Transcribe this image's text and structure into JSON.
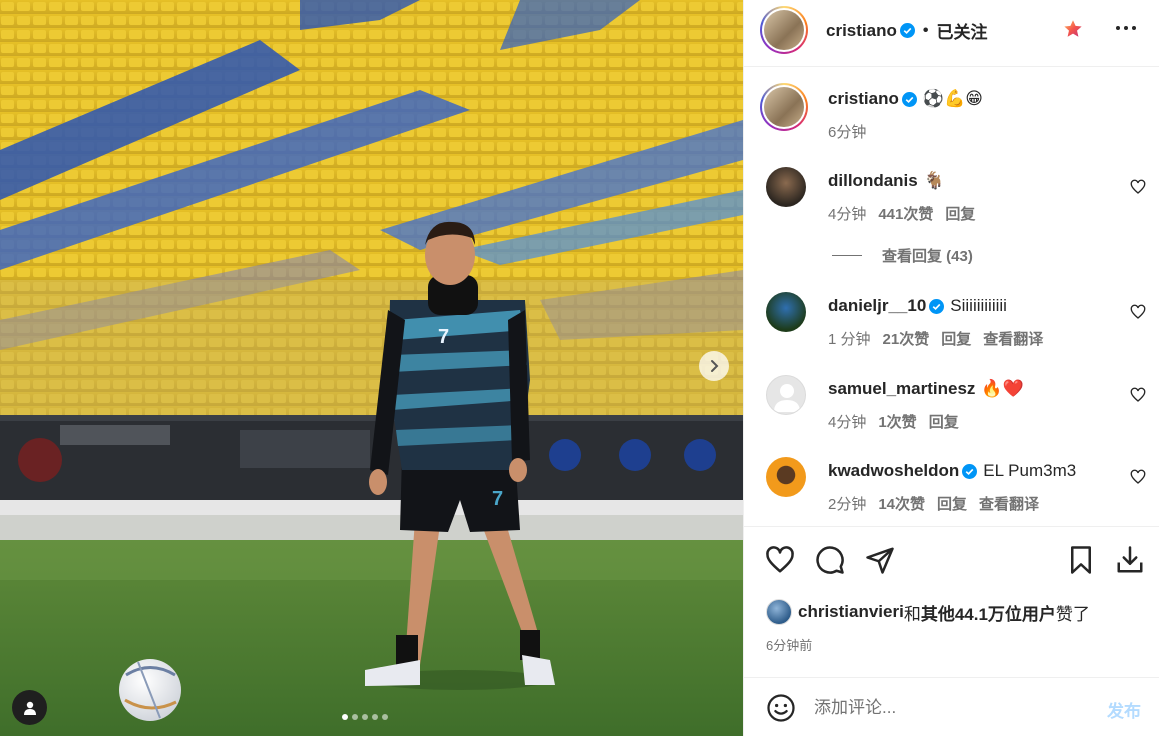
{
  "post": {
    "author": "cristiano",
    "follow_status": "已关注",
    "separator": "•",
    "caption_emoji": "⚽💪😁",
    "caption_time": "6分钟",
    "carousel_dots": 5,
    "active_dot": 1
  },
  "comments": [
    {
      "user": "dillondanis",
      "text": "🐐",
      "time": "4分钟",
      "likes": "441次赞",
      "reply": "回复",
      "translate": "",
      "verified": false
    },
    {
      "user": "danieljr__10",
      "text": "Siiiiiiiiiiii",
      "time": "1 分钟",
      "likes": "21次赞",
      "reply": "回复",
      "translate": "查看翻译",
      "verified": true
    },
    {
      "user": "samuel_martinesz",
      "text": "🔥❤️",
      "time": "4分钟",
      "likes": "1次赞",
      "reply": "回复",
      "translate": "",
      "verified": false
    },
    {
      "user": "kwadwosheldon",
      "text": "EL Pum3m3",
      "time": "2分钟",
      "likes": "14次赞",
      "reply": "回复",
      "translate": "查看翻译",
      "verified": true
    }
  ],
  "view_replies": "查看回复 (43)",
  "likes_line": {
    "user": "christianvieri",
    "connector": "和",
    "others": "其他44.1万位用户",
    "suffix": "赞了"
  },
  "post_time": "6分钟前",
  "composer": {
    "placeholder": "添加评论...",
    "post_label": "发布"
  },
  "colors": {
    "verified_blue": "#0095f6",
    "muted_text": "#737373",
    "post_button": "#b3dbff"
  }
}
